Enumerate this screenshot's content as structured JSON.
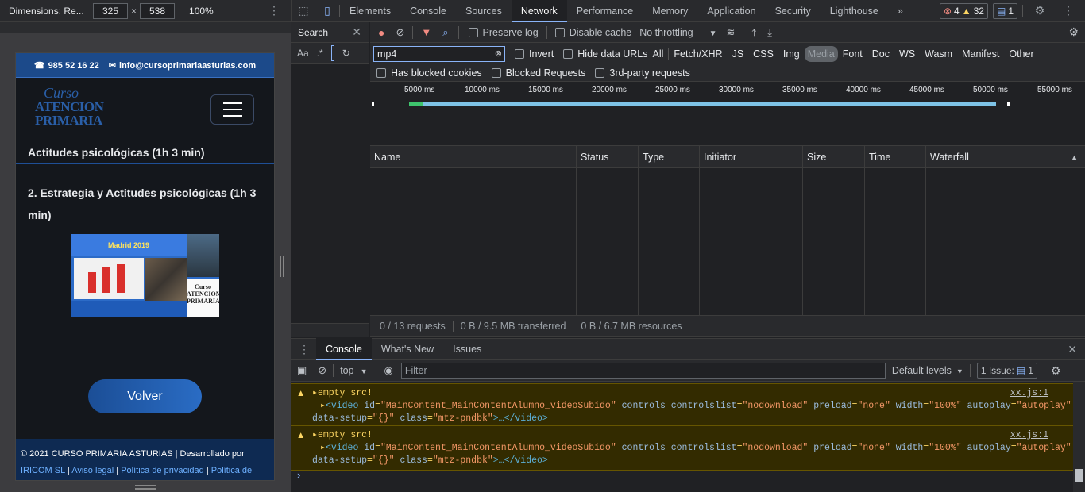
{
  "device_toolbar": {
    "dimensions_label": "Dimensions: Re...",
    "width": "325",
    "x": "×",
    "height": "538",
    "zoom": "100%",
    "more": "⋮"
  },
  "site": {
    "phone": "985 52 16 22",
    "email": "info@cursoprimariaasturias.com",
    "logo": {
      "line1": "Curso",
      "line2": "ATENCION",
      "line3": "PRIMARIA"
    },
    "section1": "Actitudes psicológicas (1h 3 min)",
    "section2": "2. Estrategia y Actitudes psicológicas (1h 3 min)",
    "thumb": {
      "title": "Madrid 2019",
      "logo": "Curso ATENCION PRIMARIA"
    },
    "button": "Volver",
    "footer": {
      "copyright": "© 2021 CURSO PRIMARIA ASTURIAS",
      "sep": "|",
      "dev": "Desarrollado por",
      "dev_link": "IRICOM SL",
      "aviso": "Aviso legal",
      "privacidad": "Política de privacidad",
      "cookies": "Política de cookies"
    }
  },
  "devtools": {
    "tabs": [
      "Elements",
      "Console",
      "Sources",
      "Network",
      "Performance",
      "Memory",
      "Application",
      "Security",
      "Lighthouse"
    ],
    "more_tabs": "»",
    "errors": "4",
    "warnings": "32",
    "issues": "1"
  },
  "search_panel": {
    "title": "Search",
    "aa": "Aa",
    "regex": ".*"
  },
  "network": {
    "preserve_log": "Preserve log",
    "disable_cache": "Disable cache",
    "throttling": "No throttling",
    "filter_value": "mp4",
    "invert": "Invert",
    "hide_data_urls": "Hide data URLs",
    "types": [
      "All",
      "Fetch/XHR",
      "JS",
      "CSS",
      "Img",
      "Media",
      "Font",
      "Doc",
      "WS",
      "Wasm",
      "Manifest",
      "Other"
    ],
    "selected_type": "Media",
    "blocked_cookies": "Has blocked cookies",
    "blocked_requests": "Blocked Requests",
    "third_party": "3rd-party requests",
    "ticks": [
      "5000 ms",
      "10000 ms",
      "15000 ms",
      "20000 ms",
      "25000 ms",
      "30000 ms",
      "35000 ms",
      "40000 ms",
      "45000 ms",
      "50000 ms",
      "55000 ms"
    ],
    "columns": [
      "Name",
      "Status",
      "Type",
      "Initiator",
      "Size",
      "Time",
      "Waterfall"
    ],
    "status": {
      "requests": "0 / 13 requests",
      "transferred": "0 B / 9.5 MB transferred",
      "resources": "0 B / 6.7 MB resources"
    }
  },
  "drawer": {
    "tabs": [
      "Console",
      "What's New",
      "Issues"
    ],
    "context": "top",
    "filter_placeholder": "Filter",
    "levels": "Default levels",
    "issues_label": "1 Issue:",
    "issues_count": "1"
  },
  "console_messages": [
    {
      "text": "empty src!",
      "source": "xx.js:1",
      "tag_open": "<video",
      "id_attr": "id",
      "id_val": "\"MainContent_MainContentAlumno_videoSubido\"",
      "attrs1": "controls controlslist",
      "cl_val": "\"nodownload\"",
      "preload": "preload",
      "preload_val": "\"none\"",
      "width": "width",
      "width_val": "\"100%\"",
      "autoplay": "autoplay",
      "autoplay_val": "\"autoplay\"",
      "data_setup": "data-setup",
      "data_setup_val": "\"{}\"",
      "class": "class",
      "class_val": "\"mtz-pndbk\"",
      "close": ">…</video>"
    },
    {
      "text": "empty src!",
      "source": "xx.js:1",
      "tag_open": "<video",
      "id_attr": "id",
      "id_val": "\"MainContent_MainContentAlumno_videoSubido\"",
      "attrs1": "controls controlslist",
      "cl_val": "\"nodownload\"",
      "preload": "preload",
      "preload_val": "\"none\"",
      "width": "width",
      "width_val": "\"100%\"",
      "autoplay": "autoplay",
      "autoplay_val": "\"autoplay\"",
      "data_setup": "data-setup",
      "data_setup_val": "\"{}\"",
      "class": "class",
      "class_val": "\"mtz-pndbk\"",
      "close": ">…</video>"
    }
  ],
  "colors": {
    "accent": "#8ab4f8",
    "warning_bg": "#332b00",
    "site_blue": "#1c4a8a"
  }
}
